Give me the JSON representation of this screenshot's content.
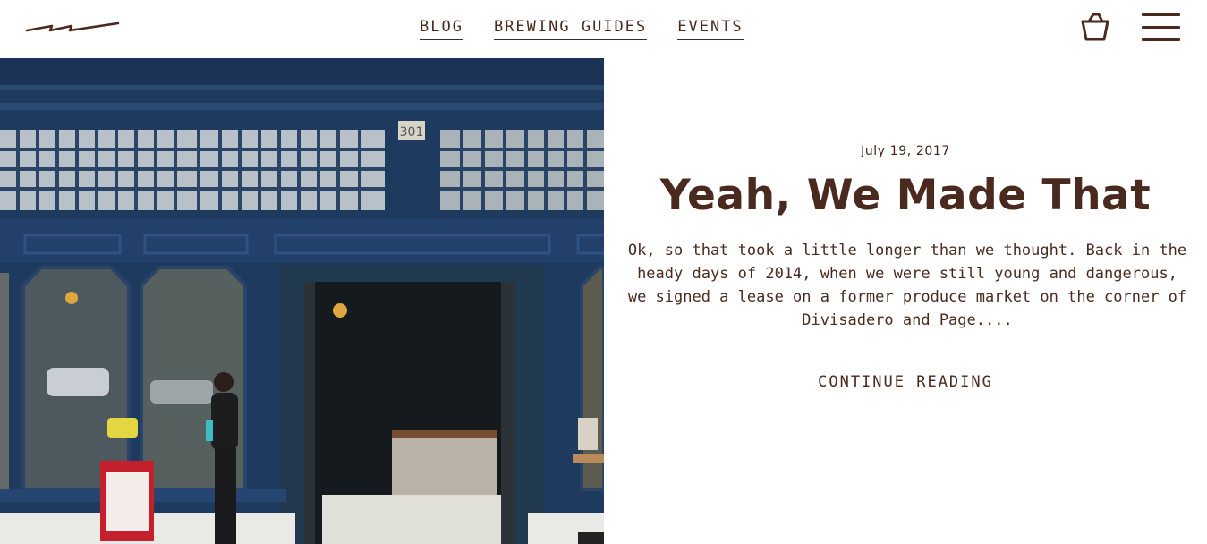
{
  "header": {
    "nav": [
      {
        "label": "BLOG"
      },
      {
        "label": "BREWING GUIDES"
      },
      {
        "label": "EVENTS"
      }
    ]
  },
  "icons": {
    "logo": "squiggle-logo",
    "cart": "basket-icon",
    "menu": "hamburger-menu-icon"
  },
  "hero": {
    "storefront_number": "301"
  },
  "article": {
    "date": "July 19, 2017",
    "title": "Yeah, We Made That",
    "excerpt": "Ok, so that took a little longer than we thought. Back in the heady days of 2014, when we were still young and dangerous, we signed a lease on a former produce market on the corner of Divisadero and Page....",
    "cta": "CONTINUE READING"
  },
  "colors": {
    "text": "#4a2a1e",
    "storefront": "#1f3a5f",
    "background": "#ffffff"
  }
}
